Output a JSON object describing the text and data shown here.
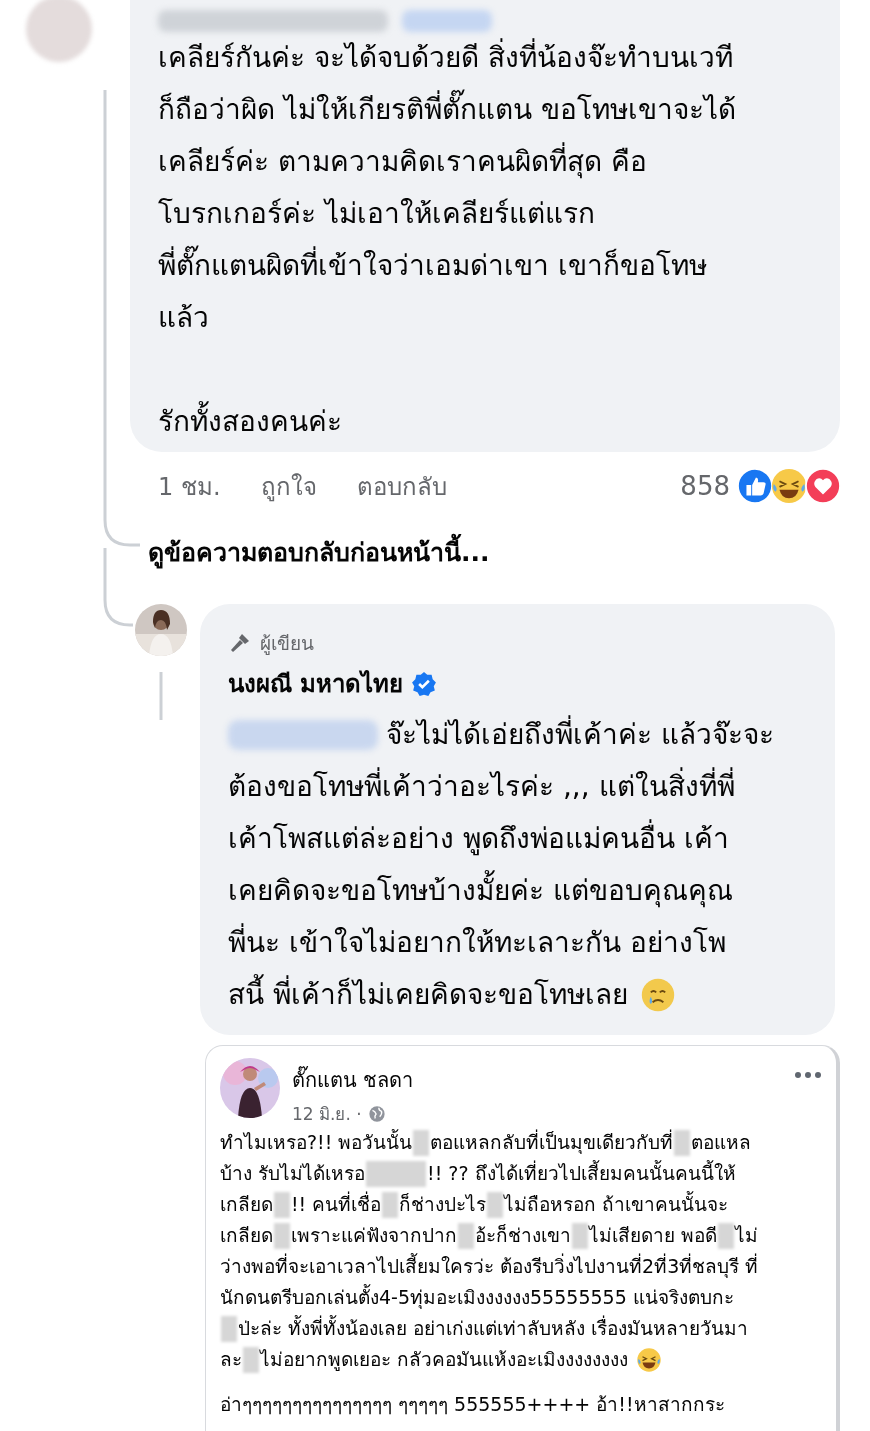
{
  "comment": {
    "paragraphs": [
      [
        "เคลียร์กันค่ะ จะได้จบด้วยดี สิ่งที่น้องจ๊ะทำบนเวที",
        "ก็ถือว่าผิด ไม่ให้เกียรติพี่ตั๊กแตน ขอโทษเขาจะได้",
        "เคลียร์ค่ะ ตามความคิดเราคนผิดที่สุด คือ",
        "โบรกเกอร์ค่ะ ไม่เอาให้เคลียร์แต่แรก",
        "พี่ตั๊กแตนผิดที่เข้าใจว่าเอมด่าเขา เขาก็ขอโทษ",
        "แล้ว"
      ],
      [
        "รักทั้งสองคนค่ะ"
      ]
    ],
    "time": "1 ชม.",
    "actions": [
      "ถูกใจ",
      "ตอบกลับ"
    ],
    "reaction_count": "858"
  },
  "view_previous": "ดูข้อความตอบกลับก่อนหน้านี้...",
  "reply": {
    "badge": "ผู้เขียน",
    "author": "นงผณี มหาดไทย",
    "verified": true,
    "lines": [
      [
        {
          "kind": "nameblur"
        },
        {
          "kind": "text",
          "text": "จ๊ะไม่ได้เอ่ยถึงพี่เค้าค่ะ แล้วจ๊ะจะ"
        }
      ],
      [
        {
          "kind": "text",
          "text": "ต้องขอโทษพี่เค้าว่าอะไรค่ะ ,,, แต่ในสิ่งที่พี่"
        }
      ],
      [
        {
          "kind": "text",
          "text": "เค้าโพสแต่ล่ะอย่าง พูดถึงพ่อแม่คนอื่น เค้า"
        }
      ],
      [
        {
          "kind": "text",
          "text": "เคยคิดจะขอโทษบ้างมั้ยค่ะ แต่ขอบคุณคุณ"
        }
      ],
      [
        {
          "kind": "text",
          "text": "พี่นะ เข้าใจไม่อยากให้ทะเลาะกัน อย่างโพ"
        }
      ],
      [
        {
          "kind": "text",
          "text": "สนี้ พี่เค้าก็ไม่เคยคิดจะขอโทษเลย"
        },
        {
          "kind": "cry"
        }
      ]
    ]
  },
  "shared_post": {
    "author": "ตั๊กแตน ชลดา",
    "date": "12 มิ.ย. ·",
    "paragraphs": [
      [
        [
          {
            "kind": "text",
            "text": "ทำไมเหรอ?!!  พอวันนั้น"
          },
          {
            "kind": "blur"
          },
          {
            "kind": "text",
            "text": "ตอแหลกลับที่เป็นมุขเดียวกับที่"
          },
          {
            "kind": "blur"
          },
          {
            "kind": "text",
            "text": "ตอแหล"
          }
        ],
        [
          {
            "kind": "text",
            "text": "บ้าง รับไม่ได้เหรอ"
          },
          {
            "kind": "wideblur"
          },
          {
            "kind": "text",
            "text": "!! ??  ถึงได้เที่ยวไปเสี้ยมคนนั้นคนนี้ให้"
          }
        ],
        [
          {
            "kind": "text",
            "text": "เกลียด"
          },
          {
            "kind": "blur"
          },
          {
            "kind": "text",
            "text": "!! คนที่เชื่อ"
          },
          {
            "kind": "blur"
          },
          {
            "kind": "text",
            "text": "ก็ช่างปะไร"
          },
          {
            "kind": "blur"
          },
          {
            "kind": "text",
            "text": "ไม่ถือหรอก ถ้าเขาคนนั้นจะ"
          }
        ],
        [
          {
            "kind": "text",
            "text": "เกลียด"
          },
          {
            "kind": "blur"
          },
          {
            "kind": "text",
            "text": "เพราะแค่ฟังจากปาก"
          },
          {
            "kind": "blur"
          },
          {
            "kind": "text",
            "text": "อ้ะก็ช่างเขา"
          },
          {
            "kind": "blur"
          },
          {
            "kind": "text",
            "text": "ไม่เสียดาย  พอดี"
          },
          {
            "kind": "blur"
          },
          {
            "kind": "text",
            "text": "ไม่"
          }
        ],
        [
          {
            "kind": "text",
            "text": "ว่างพอที่จะเอาเวลาไปเสี้ยมใครว่ะ ต้องรีบวิ่งไปงานที่2ที่3ที่ชลบุรี ที่"
          }
        ],
        [
          {
            "kind": "text",
            "text": "นักดนตรีบอกเล่นตั้ง4-5ทุ่มอะเมิงงงงงง55555555  แน่จริงตบกะ"
          }
        ],
        [
          {
            "kind": "blur"
          },
          {
            "kind": "text",
            "text": "ป่ะล่ะ ทั้งพี่ทั้งน้องเลย อย่าเก่งแต่เท่าลับหลัง เรื่องมันหลายวันมา"
          }
        ],
        [
          {
            "kind": "text",
            "text": "ละ"
          },
          {
            "kind": "blur"
          },
          {
            "kind": "text",
            "text": "ไม่อยากพูดเยอะ กลัวคอมันแห้งอะเมิงงงงงงงง"
          },
          {
            "kind": "laugh"
          }
        ]
      ],
      [
        [
          {
            "kind": "text",
            "text": "อ่าๆๆๆๆๆๆๆๆๆๆๆๆๆๆๆ ๆๆๆๆๆ 555555++++ อ้า!!หาสากกระ"
          }
        ]
      ]
    ]
  }
}
